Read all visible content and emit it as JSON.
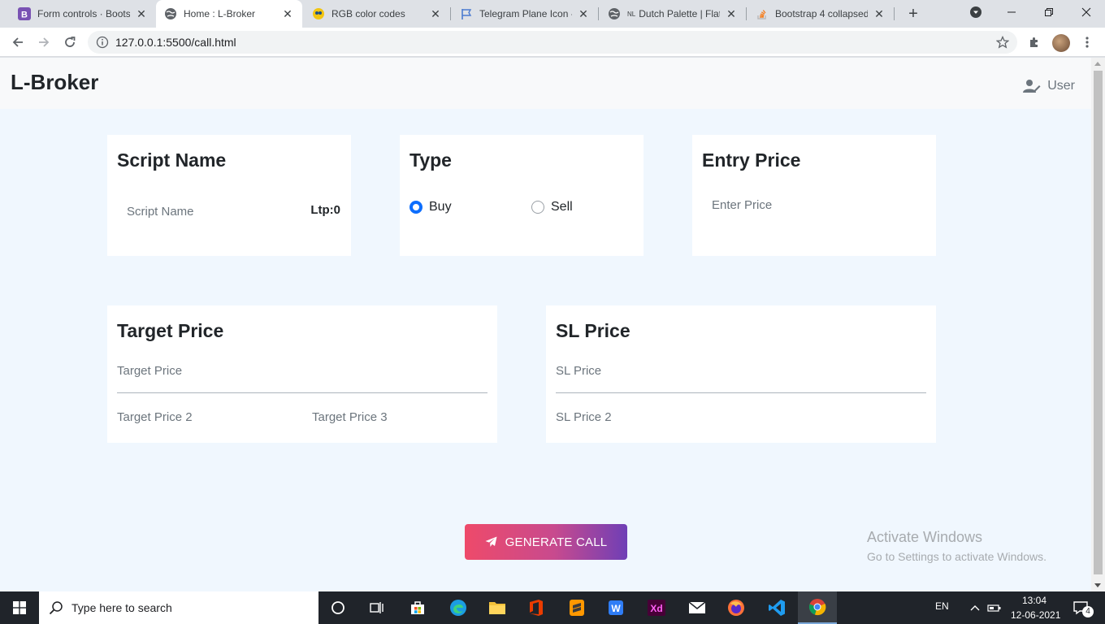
{
  "browser": {
    "tabs": [
      {
        "title": "Form controls · Bootst",
        "favicon": "bootstrap-icon",
        "active": false
      },
      {
        "title": "Home : L-Broker",
        "favicon": "globe-icon",
        "active": true
      },
      {
        "title": "RGB color codes",
        "favicon": "rgb-icon",
        "active": false
      },
      {
        "title": "Telegram Plane Icon -",
        "favicon": "flag-icon",
        "active": false
      },
      {
        "title": "Dutch Palette | Flat",
        "favicon": "globe-icon",
        "prefix": "NL",
        "active": false
      },
      {
        "title": "Bootstrap 4 collapsed",
        "favicon": "stackoverflow-icon",
        "active": false
      }
    ],
    "url": "127.0.0.1:5500/call.html"
  },
  "page": {
    "brand": "L-Broker",
    "user_label": "User",
    "cards": {
      "script": {
        "title": "Script Name",
        "placeholder": "Script Name",
        "ltp": "Ltp:0"
      },
      "type": {
        "title": "Type",
        "options": [
          {
            "label": "Buy",
            "checked": true
          },
          {
            "label": "Sell",
            "checked": false
          }
        ]
      },
      "entry": {
        "title": "Entry Price",
        "placeholder": "Enter Price"
      },
      "target": {
        "title": "Target Price",
        "field1": "Target Price",
        "field2": "Target Price 2",
        "field3": "Target Price 3"
      },
      "sl": {
        "title": "SL Price",
        "field1": "SL Price",
        "field2": "SL Price 2"
      }
    },
    "generate_button": "GENERATE CALL",
    "watermark": {
      "line1": "Activate Windows",
      "line2": "Go to Settings to activate Windows."
    }
  },
  "taskbar": {
    "search_placeholder": "Type here to search",
    "language": "EN",
    "time": "13:04",
    "date": "12-06-2021",
    "notifications": "4"
  },
  "colors": {
    "accent": "#0d6efd",
    "page_bg": "#f0f7fe",
    "button_gradient_start": "#ee4a6a",
    "button_gradient_end": "#6f3fb6"
  }
}
